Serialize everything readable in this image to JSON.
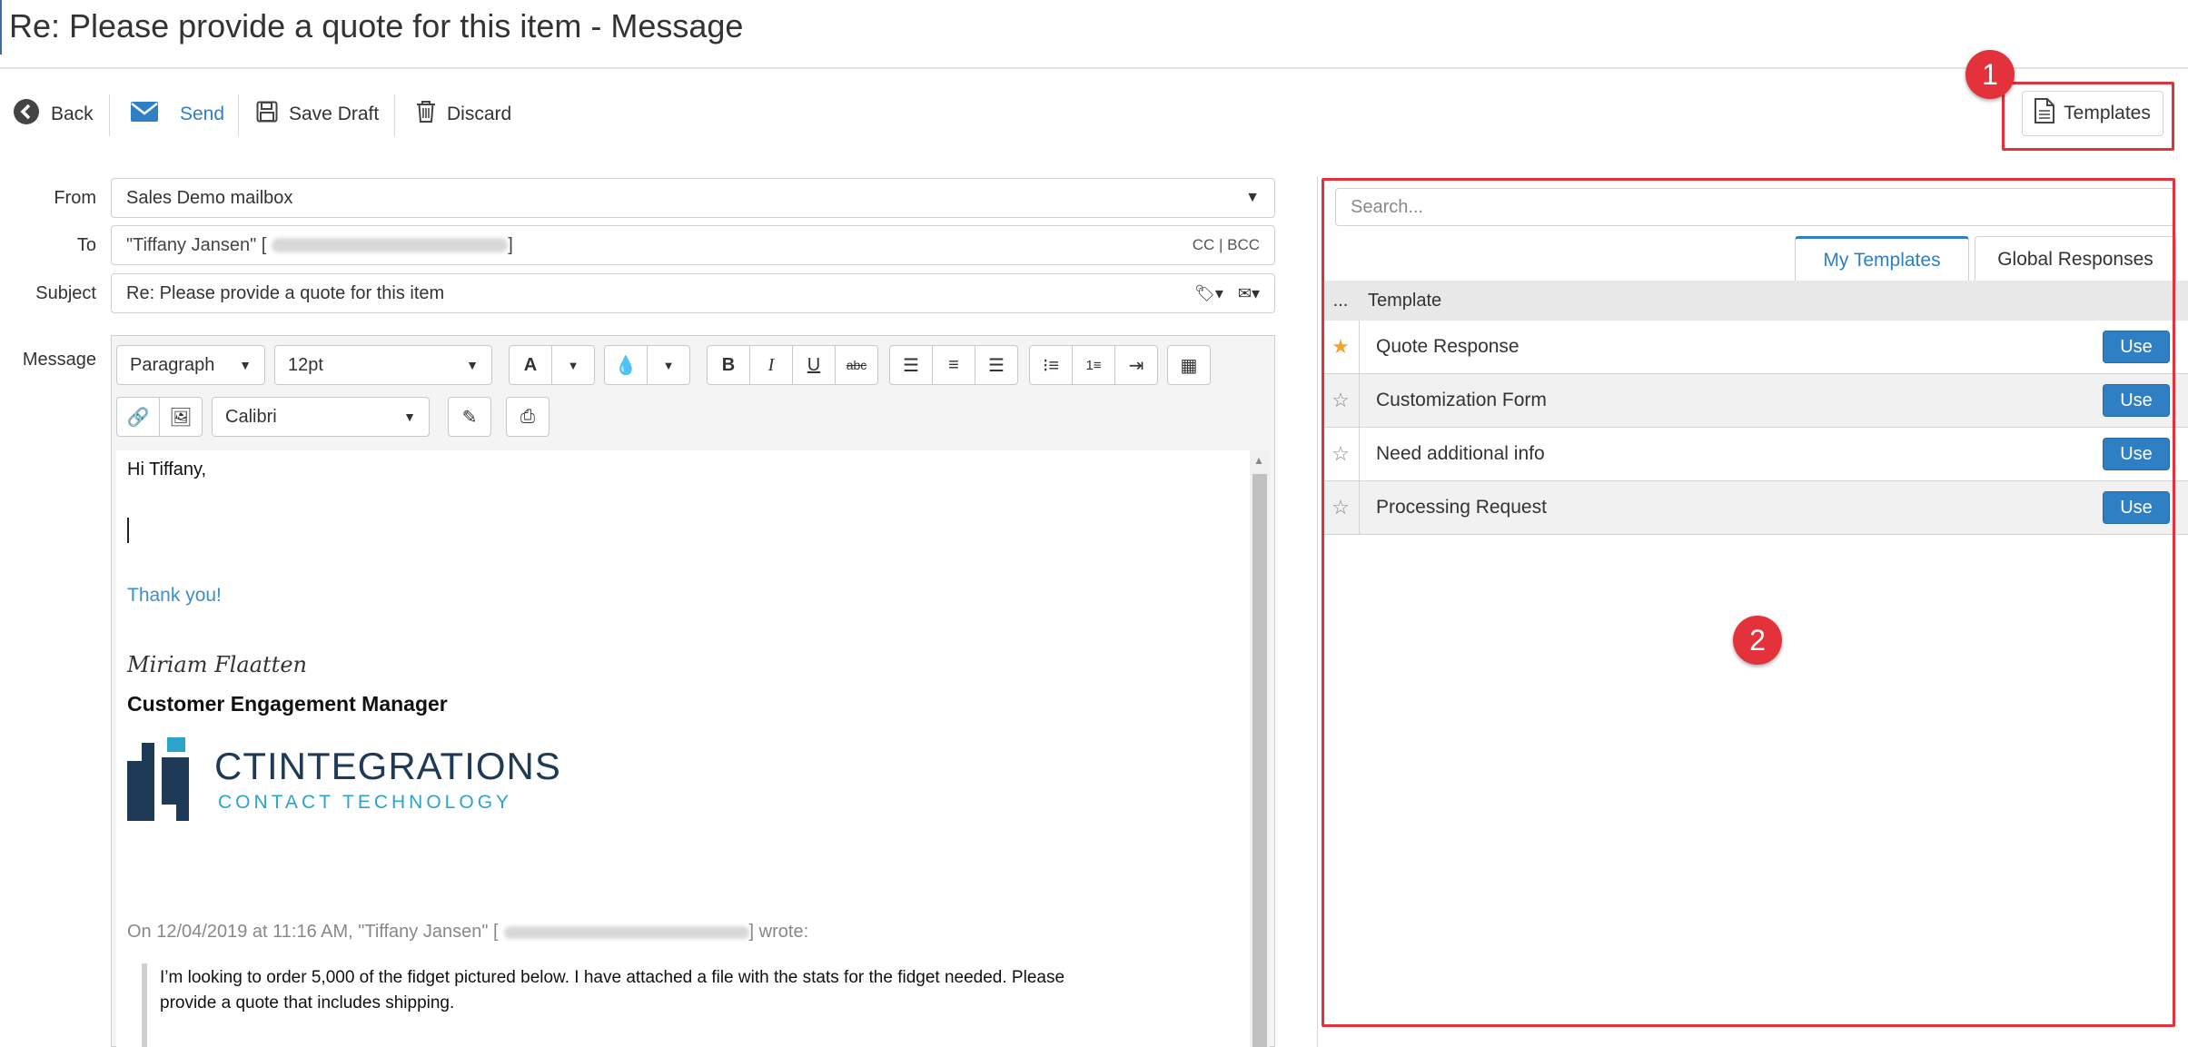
{
  "window": {
    "title": "Re: Please provide a quote for this item - Message"
  },
  "toolbar": {
    "back": "Back",
    "send": "Send",
    "save_draft": "Save Draft",
    "discard": "Discard",
    "templates": "Templates"
  },
  "annotations": {
    "badge1": "1",
    "badge2": "2"
  },
  "form": {
    "from_label": "From",
    "from_value": "Sales Demo mailbox",
    "to_label": "To",
    "to_value": "\"Tiffany Jansen\" [",
    "to_value_end": "]",
    "cc_bcc": "CC | BCC",
    "subject_label": "Subject",
    "subject_value": "Re: Please provide a quote for this item",
    "message_label": "Message"
  },
  "editor": {
    "format_select": "Paragraph",
    "size_select": "12pt",
    "font_select": "Calibri",
    "icons": [
      "font-color-icon",
      "highlight-icon",
      "bold-icon",
      "italic-icon",
      "underline-icon",
      "strikethrough-icon",
      "align-left-icon",
      "align-center-icon",
      "align-right-icon",
      "bullet-list-icon",
      "numbered-list-icon",
      "indent-icon",
      "table-icon",
      "link-icon",
      "image-icon",
      "pen-icon",
      "print-icon"
    ]
  },
  "body": {
    "greeting": "Hi Tiffany,",
    "thanks": "Thank you!",
    "signature_name": "Miriam Flaatten",
    "signature_title": "Customer Engagement Manager",
    "logo_name": "CTINTEGRATIONS",
    "logo_tagline": "CONTACT TECHNOLOGY",
    "quote_header_start": "On 12/04/2019 at 11:16 AM, \"Tiffany Jansen\" [",
    "quote_header_end": "] wrote:",
    "quote_line1": "I’m looking to order 5,000 of the fidget pictured below. I have attached a file with the stats for the fidget needed. Please",
    "quote_line2": "provide a quote that includes shipping."
  },
  "templates_panel": {
    "search_placeholder": "Search...",
    "tab_my": "My Templates",
    "tab_global": "Global Responses",
    "col_fav": "...",
    "col_template": "Template",
    "use_label": "Use",
    "rows": [
      {
        "name": "Quote Response",
        "favorite": true
      },
      {
        "name": "Customization Form",
        "favorite": false
      },
      {
        "name": "Need additional info",
        "favorite": false
      },
      {
        "name": "Processing Request",
        "favorite": false
      }
    ]
  },
  "colors": {
    "accent": "#2e7fc4",
    "annotation": "#e3323b",
    "star": "#f0a531",
    "link_text": "#3d8fc8"
  }
}
